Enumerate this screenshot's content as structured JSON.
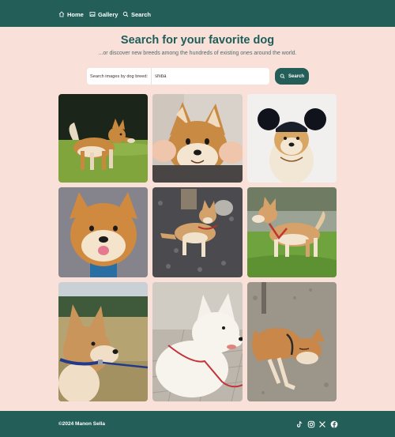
{
  "nav": {
    "items": [
      {
        "label": "Home",
        "icon": "home-icon"
      },
      {
        "label": "Gallery",
        "icon": "gallery-icon"
      },
      {
        "label": "Search",
        "icon": "search-icon"
      }
    ]
  },
  "header": {
    "title": "Search for your favorite dog",
    "subtitle": "...or discover new breeds among the hundreds of existing ones around the world."
  },
  "search": {
    "label": "Search images by dog breed:",
    "value": "shiba",
    "button_label": "Search"
  },
  "gallery": {
    "images": [
      {
        "subject": "shiba-standing-grass"
      },
      {
        "subject": "shiba-face-squeezed"
      },
      {
        "subject": "shiba-mouse-ears-hat"
      },
      {
        "subject": "shiba-smiling-closeup"
      },
      {
        "subject": "shiba-lying-gravel"
      },
      {
        "subject": "shiba-red-harness-grass"
      },
      {
        "subject": "shiba-blue-collar-field"
      },
      {
        "subject": "white-shiba-red-leash"
      },
      {
        "subject": "shiba-sleeping-ground"
      }
    ]
  },
  "footer": {
    "copyright": "©2024 Manon Sella",
    "social": [
      "tiktok-icon",
      "instagram-icon",
      "x-icon",
      "facebook-icon"
    ]
  },
  "colors": {
    "primary": "#235e59",
    "background": "#f9e1da",
    "text": "#1f5d58"
  }
}
